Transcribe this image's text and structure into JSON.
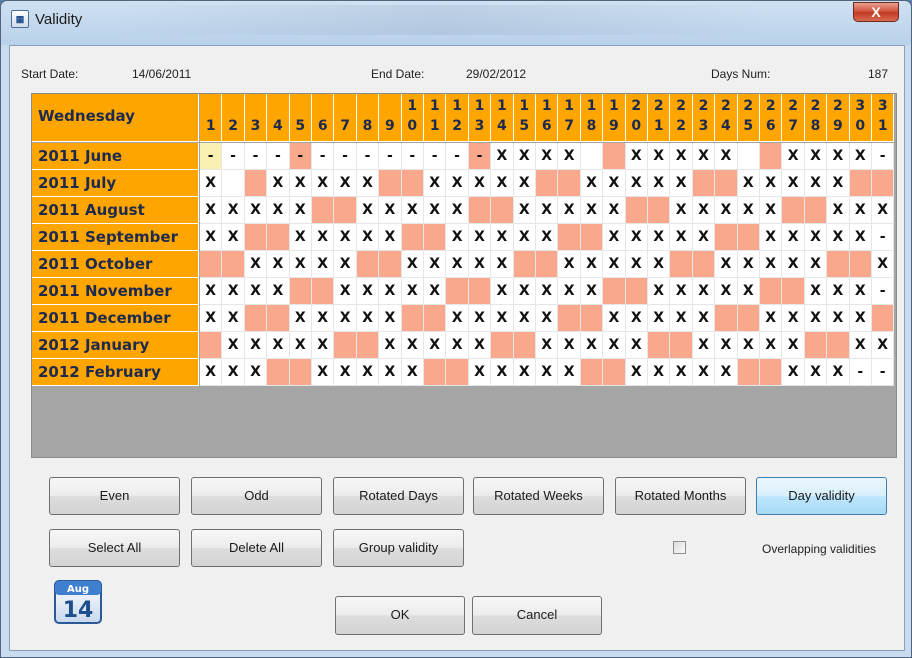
{
  "window": {
    "title": "Validity",
    "title_icon": "calendar-icon",
    "close_label": "X"
  },
  "info": {
    "start_label": "Start Date:",
    "start_value": "14/06/2011",
    "end_label": "End Date:",
    "end_value": "29/02/2012",
    "days_label": "Days Num:",
    "days_value": "187"
  },
  "grid": {
    "corner_label": "Wednesday",
    "days": [
      "1",
      "2",
      "3",
      "4",
      "5",
      "6",
      "7",
      "8",
      "9",
      "10",
      "11",
      "12",
      "13",
      "14",
      "15",
      "16",
      "17",
      "18",
      "19",
      "20",
      "21",
      "22",
      "23",
      "24",
      "25",
      "26",
      "27",
      "28",
      "29",
      "30",
      "31"
    ],
    "rows": [
      {
        "label": "2011 June",
        "cells": [
          "-",
          "-",
          "-",
          "-",
          "-",
          "-",
          "-",
          "-",
          "-",
          "-",
          "-",
          "-",
          "-",
          "X",
          "X",
          "X",
          "X",
          "",
          "",
          "X",
          "X",
          "X",
          "X",
          "X",
          "",
          "",
          "X",
          "X",
          "X",
          "X",
          "-"
        ]
      },
      {
        "label": "2011 July",
        "cells": [
          "X",
          "",
          "",
          "X",
          "X",
          "X",
          "X",
          "X",
          "",
          "",
          "X",
          "X",
          "X",
          "X",
          "X",
          "",
          "",
          "X",
          "X",
          "X",
          "X",
          "X",
          "",
          "",
          "X",
          "X",
          "X",
          "X",
          "X",
          "",
          ""
        ]
      },
      {
        "label": "2011 August",
        "cells": [
          "X",
          "X",
          "X",
          "X",
          "X",
          "",
          "",
          "X",
          "X",
          "X",
          "X",
          "X",
          "",
          "",
          "X",
          "X",
          "X",
          "X",
          "X",
          "",
          "",
          "X",
          "X",
          "X",
          "X",
          "X",
          "",
          "",
          "X",
          "X",
          "X"
        ]
      },
      {
        "label": "2011 September",
        "cells": [
          "X",
          "X",
          "",
          "",
          "X",
          "X",
          "X",
          "X",
          "X",
          "",
          "",
          "X",
          "X",
          "X",
          "X",
          "X",
          "",
          "",
          "X",
          "X",
          "X",
          "X",
          "X",
          "",
          "",
          "X",
          "X",
          "X",
          "X",
          "X",
          "-"
        ]
      },
      {
        "label": "2011 October",
        "cells": [
          "",
          "",
          "X",
          "X",
          "X",
          "X",
          "X",
          "",
          "",
          "X",
          "X",
          "X",
          "X",
          "X",
          "",
          "",
          "X",
          "X",
          "X",
          "X",
          "X",
          "",
          "",
          "X",
          "X",
          "X",
          "X",
          "X",
          "",
          "",
          "X"
        ]
      },
      {
        "label": "2011 November",
        "cells": [
          "X",
          "X",
          "X",
          "X",
          "",
          "",
          "X",
          "X",
          "X",
          "X",
          "X",
          "",
          "",
          "X",
          "X",
          "X",
          "X",
          "X",
          "",
          "",
          "X",
          "X",
          "X",
          "X",
          "X",
          "",
          "",
          "X",
          "X",
          "X",
          "-"
        ]
      },
      {
        "label": "2011 December",
        "cells": [
          "X",
          "X",
          "",
          "",
          "X",
          "X",
          "X",
          "X",
          "X",
          "",
          "",
          "X",
          "X",
          "X",
          "X",
          "X",
          "",
          "",
          "X",
          "X",
          "X",
          "X",
          "X",
          "",
          "",
          "X",
          "X",
          "X",
          "X",
          "X",
          ""
        ]
      },
      {
        "label": "2012 January",
        "cells": [
          "",
          "X",
          "X",
          "X",
          "X",
          "X",
          "",
          "",
          "X",
          "X",
          "X",
          "X",
          "X",
          "",
          "",
          "X",
          "X",
          "X",
          "X",
          "X",
          "",
          "",
          "X",
          "X",
          "X",
          "X",
          "X",
          "",
          "",
          "X",
          "X"
        ]
      },
      {
        "label": "2012 February",
        "cells": [
          "X",
          "X",
          "X",
          "",
          "",
          "X",
          "X",
          "X",
          "X",
          "X",
          "",
          "",
          "X",
          "X",
          "X",
          "X",
          "X",
          "",
          "",
          "X",
          "X",
          "X",
          "X",
          "X",
          "",
          "",
          "X",
          "X",
          "X",
          "-",
          "-"
        ]
      }
    ],
    "highlight_colors": {
      "weekend": "#f9a88c",
      "selected": "#f8f0b0",
      "header": "#ffa500"
    }
  },
  "buttons": {
    "even": "Even",
    "odd": "Odd",
    "rotated_days": "Rotated Days",
    "rotated_weeks": "Rotated Weeks",
    "rotated_months": "Rotated Months",
    "day_validity": "Day validity",
    "select_all": "Select All",
    "delete_all": "Delete All",
    "group_validity": "Group validity",
    "ok": "OK",
    "cancel": "Cancel"
  },
  "overlap": {
    "label": "Overlapping validities",
    "checked": false
  },
  "calendar_icon": {
    "month": "Aug",
    "day": "14"
  }
}
